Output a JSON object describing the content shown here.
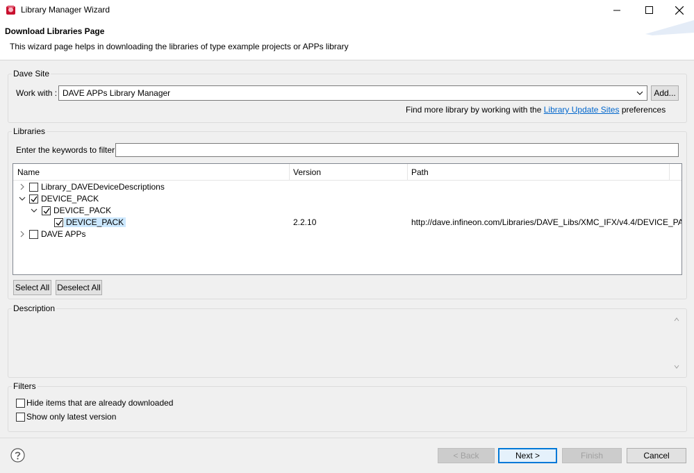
{
  "window": {
    "title": "Library Manager Wizard",
    "icon": "dave-app-icon",
    "controls": [
      "minimize-icon",
      "maximize-icon",
      "close-icon"
    ]
  },
  "banner": {
    "title": "Download Libraries Page",
    "description": "This wizard page helps in downloading the libraries of type example projects or APPs library"
  },
  "dave_site": {
    "group_label": "Dave Site",
    "work_with_label": "Work with :",
    "work_with_value": "DAVE APPs Library Manager",
    "add_button": "Add...",
    "find_more_prefix": "Find more library by working with the ",
    "find_more_link": "Library Update Sites",
    "find_more_suffix": " preferences"
  },
  "libraries": {
    "group_label": "Libraries",
    "filter_label": "Enter the keywords to filter :",
    "filter_value": "",
    "columns": [
      "Name",
      "Version",
      "Path"
    ],
    "rows": [
      {
        "name": "Library_DAVEDeviceDescriptions",
        "version": "",
        "path": "",
        "expanded": false,
        "checked": false
      },
      {
        "name": "DEVICE_PACK",
        "version": "",
        "path": "",
        "expanded": true,
        "checked": true
      },
      {
        "name": "DEVICE_PACK",
        "version": "",
        "path": "",
        "expanded": true,
        "checked": true
      },
      {
        "name": "DEVICE_PACK",
        "version": "2.2.10",
        "path": "http://dave.infineon.com/Libraries/DAVE_Libs/XMC_IFX/v4.4/DEVICE_PA...",
        "checked": true,
        "selected": true
      },
      {
        "name": "DAVE APPs",
        "version": "",
        "path": "",
        "expanded": false,
        "checked": false
      }
    ],
    "select_all": "Select All",
    "deselect_all": "Deselect All"
  },
  "description": {
    "group_label": "Description"
  },
  "filters": {
    "group_label": "Filters",
    "hide_downloaded": "Hide items that are already downloaded",
    "latest_only": "Show only latest version"
  },
  "footer": {
    "help_icon": "help-icon",
    "back": "< Back",
    "next": "Next >",
    "finish": "Finish",
    "cancel": "Cancel"
  },
  "colors": {
    "link": "#0066cc",
    "selection": "#cce8ff",
    "default_button_border": "#0078d7"
  }
}
